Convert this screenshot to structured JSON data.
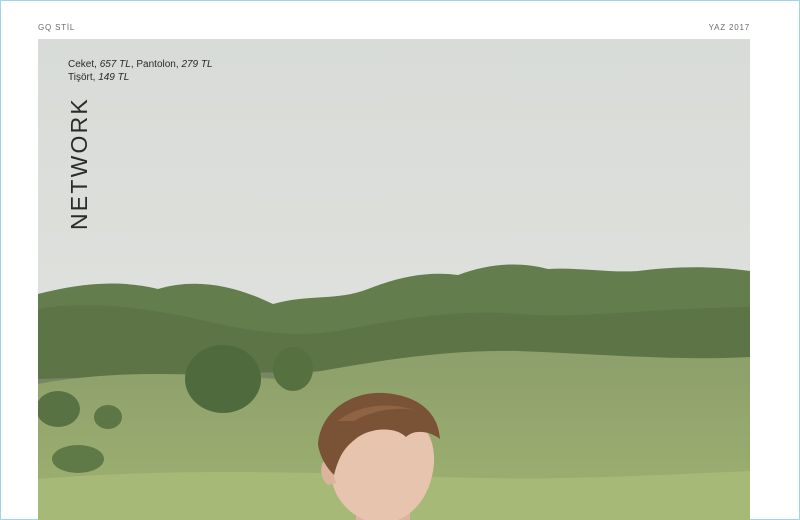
{
  "header": {
    "left_label": "GQ STİL",
    "right_label": "YAZ 2017"
  },
  "caption": {
    "item1_name": "Ceket, ",
    "item1_price": "657 TL",
    "sep1": ", ",
    "item2_name": "Pantolon, ",
    "item2_price": "279 TL",
    "item3_name": "Tişört, ",
    "item3_price": "149 TL"
  },
  "section_title": "NETWORK",
  "photo": {
    "subject": "model-portrait",
    "colors": {
      "sky": "#dcdfdb",
      "treeline": "#5f7a4a",
      "hill": "#8ea26a",
      "meadow": "#9bb06e",
      "hair": "#7a5236",
      "skin": "#e6c2ac"
    }
  }
}
